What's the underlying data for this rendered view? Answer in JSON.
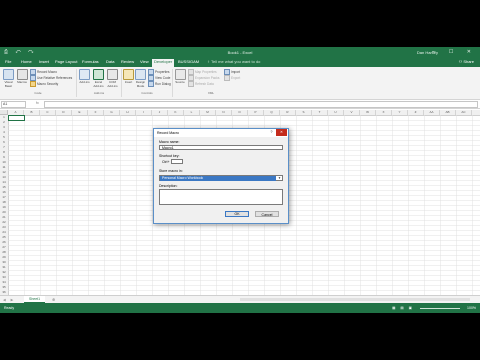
{
  "app": {
    "title": "Book1 - Excel",
    "user": "Dan Hartley",
    "quick_access": "⎙ ↶ ↷",
    "window_controls": "─ ☐ ✕"
  },
  "tabs": [
    {
      "label": "File",
      "active": false
    },
    {
      "label": "Home",
      "active": false
    },
    {
      "label": "Insert",
      "active": false
    },
    {
      "label": "Page Layout",
      "active": false
    },
    {
      "label": "Formulas",
      "active": false
    },
    {
      "label": "Data",
      "active": false
    },
    {
      "label": "Review",
      "active": false
    },
    {
      "label": "View",
      "active": false
    },
    {
      "label": "Developer",
      "active": true
    },
    {
      "label": "BUSSIGAM",
      "active": false
    }
  ],
  "tell_me": "Tell me what you want to do",
  "share": "Share",
  "ribbon": {
    "visual_basic": "Visual Basic",
    "macros": "Macros",
    "record_macro": "Record Macro",
    "use_relative": "Use Relative References",
    "macro_security": "Macro Security",
    "code_group": "Code",
    "addins": "Add-ins",
    "excel_addins": "Excel Add-ins",
    "com_addins": "COM Add-ins",
    "addins_group": "Add-ins",
    "insert": "Insert",
    "design_mode": "Design Mode",
    "properties": "Properties",
    "view_code": "View Code",
    "run_dialog": "Run Dialog",
    "controls_group": "Controls",
    "source": "Source",
    "map_properties": "Map Properties",
    "expansion_packs": "Expansion Packs",
    "refresh_data": "Refresh Data",
    "import": "Import",
    "export": "Export",
    "xml_group": "XML"
  },
  "formula_bar": {
    "name_box": "A1",
    "fx": "fx",
    "value": ""
  },
  "columns": [
    "A",
    "B",
    "C",
    "D",
    "E",
    "F",
    "G",
    "H",
    "I",
    "J",
    "K",
    "L",
    "M",
    "N",
    "O",
    "P",
    "Q",
    "R",
    "S",
    "T",
    "U",
    "V",
    "W",
    "X",
    "Y",
    "Z",
    "AA",
    "AB",
    "AC"
  ],
  "rows": [
    "1",
    "2",
    "3",
    "4",
    "5",
    "6",
    "7",
    "8",
    "9",
    "10",
    "11",
    "12",
    "13",
    "14",
    "15",
    "16",
    "17",
    "18",
    "19",
    "20",
    "21",
    "22",
    "23",
    "24",
    "25",
    "26",
    "27",
    "28",
    "29",
    "30",
    "31",
    "32",
    "33",
    "34",
    "35",
    "36"
  ],
  "sheet": {
    "nav": "◀ ▶",
    "tab": "Sheet1",
    "add": "⊕"
  },
  "status": {
    "ready": "Ready",
    "views": "▦ ▤ ▣",
    "zoom": "100%"
  },
  "dialog": {
    "title": "Record Macro",
    "help": "?",
    "close": "✕",
    "macro_name_label": "Macro name:",
    "macro_name_value": "Macro1",
    "shortcut_label": "Shortcut key:",
    "shortcut_prefix": "Ctrl+",
    "shortcut_value": "",
    "store_label": "Store macro in:",
    "store_value": "Personal Macro Workbook",
    "description_label": "Description:",
    "description_value": "",
    "ok": "OK",
    "cancel": "Cancel"
  },
  "colors": {
    "excel_green": "#217346",
    "selection_blue": "#3b78c4"
  }
}
